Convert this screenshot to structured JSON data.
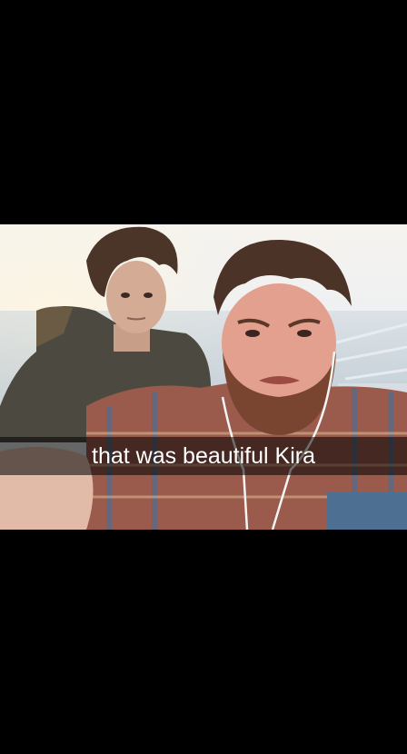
{
  "snap": {
    "caption": "that was beautiful Kira"
  }
}
